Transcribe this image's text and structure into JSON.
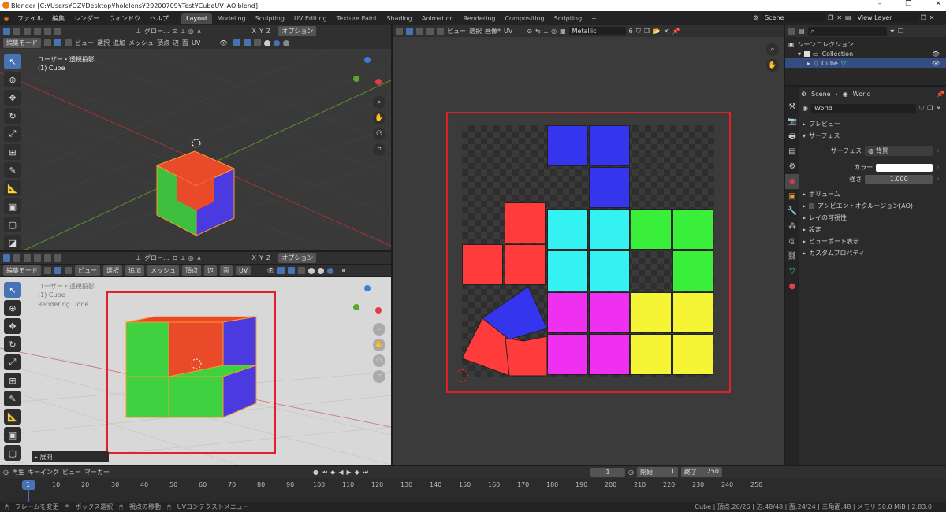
{
  "titlebar": {
    "title": "Blender [C:¥Users¥OZ¥Desktop¥hololens¥20200709¥Test¥CubeUV_AO.blend]"
  },
  "menu": {
    "items": [
      "ファイル",
      "編集",
      "レンダー",
      "ウィンドウ",
      "ヘルプ"
    ]
  },
  "workspaces": [
    "Layout",
    "Modeling",
    "Sculpting",
    "UV Editing",
    "Texture Paint",
    "Shading",
    "Animation",
    "Rendering",
    "Compositing",
    "Scripting"
  ],
  "scene": {
    "label": "Scene",
    "view_layer": "View Layer"
  },
  "viewport_top": {
    "mode": "編集モード",
    "menus": [
      "ビュー",
      "選択",
      "追加",
      "メッシュ",
      "頂点",
      "辺",
      "面",
      "UV"
    ],
    "options": "オプション",
    "transform": "グロー...",
    "info_line1": "ユーザー・透視投影",
    "info_line2": "(1) Cube",
    "xyz": [
      "X",
      "Y",
      "Z"
    ]
  },
  "viewport_bottom": {
    "mode": "編集モード",
    "menus": [
      "ビュー",
      "選択",
      "追加",
      "メッシュ",
      "頂点",
      "辺",
      "面",
      "UV"
    ],
    "options": "オプション",
    "transform": "グロー...",
    "info_line1": "ユーザー・透視投影",
    "info_line2": "(1) Cube",
    "info_line3": "Rendering Done",
    "panel": "展開",
    "xyz": [
      "X",
      "Y",
      "Z"
    ]
  },
  "uv_editor": {
    "menus": [
      "ビュー",
      "選択",
      "画像*",
      "UV"
    ],
    "image_name": "Metallic",
    "users": "6"
  },
  "outliner": {
    "root": "シーンコレクション",
    "collection": "Collection",
    "object": "Cube"
  },
  "properties": {
    "tab_scene": "Scene",
    "tab_world": "World",
    "world_name": "World",
    "sections": [
      "プレビュー",
      "サーフェス"
    ],
    "surface_label": "サーフェス",
    "surface_value": "背景",
    "color_label": "カラー",
    "strength_label": "強さ",
    "strength_value": "1.000",
    "more_sections": [
      "ボリューム",
      "アンビエントオクルージョン(AO)",
      "レイの可視性",
      "設定",
      "ビューポート表示",
      "カスタムプロパティ"
    ]
  },
  "timeline": {
    "menus": [
      "再生",
      "キーイング",
      "ビュー",
      "マーカー"
    ],
    "current_frame": "1",
    "start_label": "開始",
    "start": "1",
    "end_label": "終了",
    "end": "250",
    "ticks": [
      "1",
      "10",
      "20",
      "30",
      "40",
      "50",
      "60",
      "70",
      "80",
      "90",
      "100",
      "110",
      "120",
      "130",
      "140",
      "150",
      "160",
      "170",
      "180",
      "190",
      "200",
      "210",
      "220",
      "230",
      "240",
      "250"
    ]
  },
  "statusbar": {
    "items": [
      "フレームを変更",
      "ボックス選択",
      "視点の移動",
      "UVコンテクストメニュー"
    ],
    "stats": "Cube | 頂点:26/26 | 辺:48/48 | 面:24/24 | 三角面:48 | メモリ:50.0 MiB | 2.83.0"
  },
  "colors": {
    "accent": "#4772b3",
    "red_outline": "#e2202a",
    "face_red": "#ff3b3b",
    "face_green": "#3aef3a",
    "face_blue": "#3535ee",
    "face_cyan": "#35f2f2",
    "face_magenta": "#f030f0",
    "face_yellow": "#f5f535"
  }
}
